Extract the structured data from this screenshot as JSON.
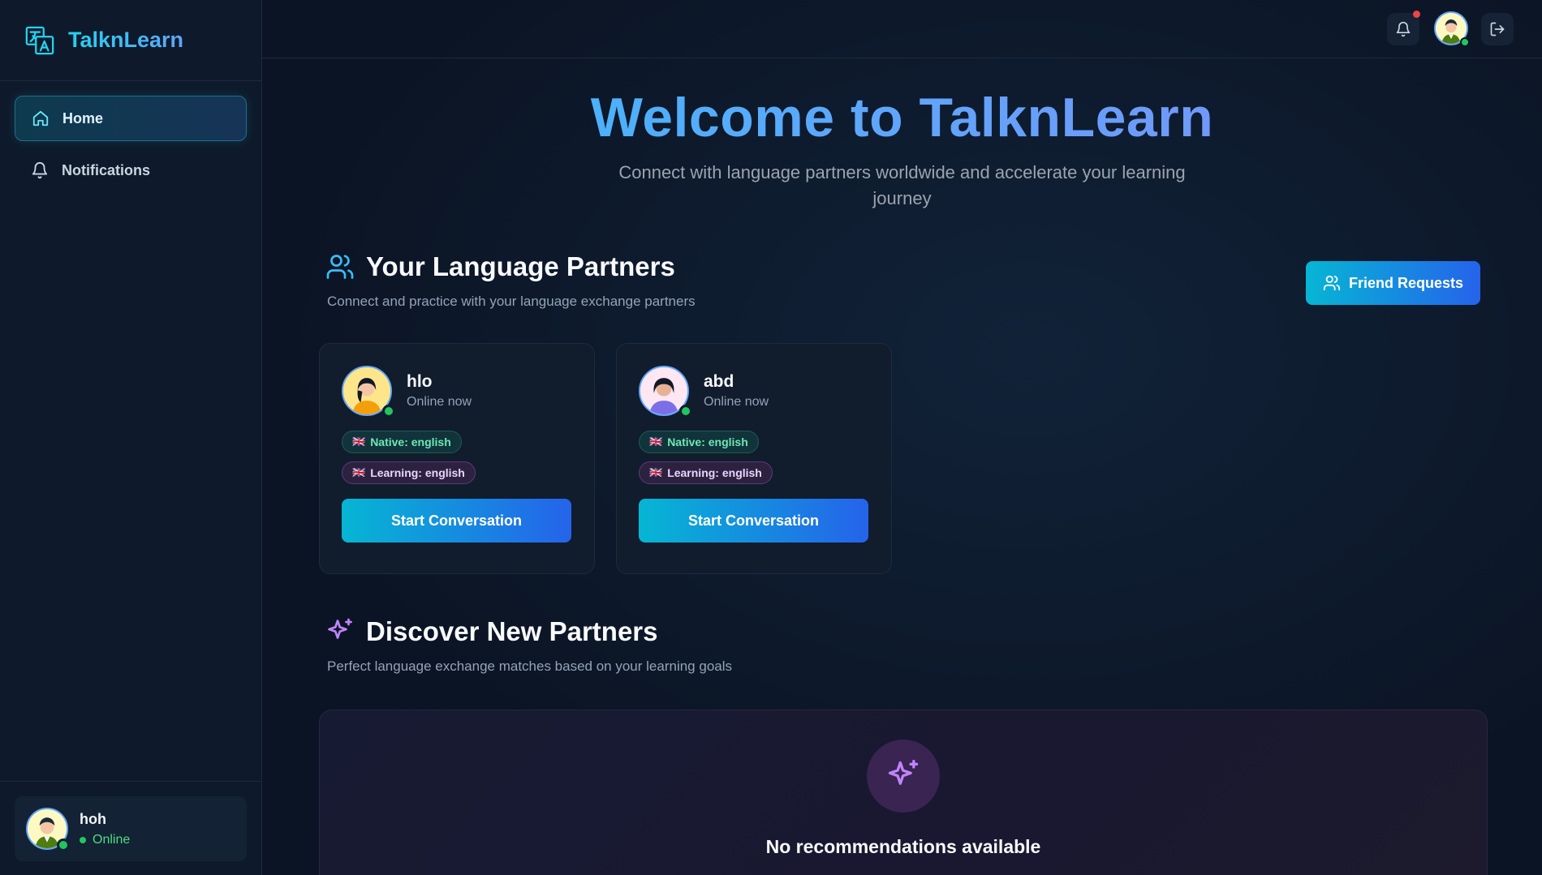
{
  "app": {
    "name": "TalknLearn"
  },
  "sidebar": {
    "items": [
      {
        "label": "Home",
        "icon": "home-icon",
        "active": true
      },
      {
        "label": "Notifications",
        "icon": "bell-icon",
        "active": false
      }
    ],
    "user": {
      "name": "hoh",
      "status": "Online"
    }
  },
  "hero": {
    "title": "Welcome to TalknLearn",
    "subtitle": "Connect with language partners worldwide and accelerate your learning journey"
  },
  "partners_section": {
    "title": "Your Language Partners",
    "subtitle": "Connect and practice with your language exchange partners",
    "friend_requests_label": "Friend Requests",
    "partners": [
      {
        "name": "hlo",
        "status": "Online now",
        "native": "Native: english",
        "learning": "Learning: english",
        "action": "Start Conversation"
      },
      {
        "name": "abd",
        "status": "Online now",
        "native": "Native: english",
        "learning": "Learning: english",
        "action": "Start Conversation"
      }
    ]
  },
  "discover_section": {
    "title": "Discover New Partners",
    "subtitle": "Perfect language exchange matches based on your learning goals",
    "empty_title": "No recommendations available"
  },
  "colors": {
    "accent_start": "#06b6d4",
    "accent_end": "#2563eb",
    "online": "#22c55e",
    "purple": "#c084fc"
  }
}
